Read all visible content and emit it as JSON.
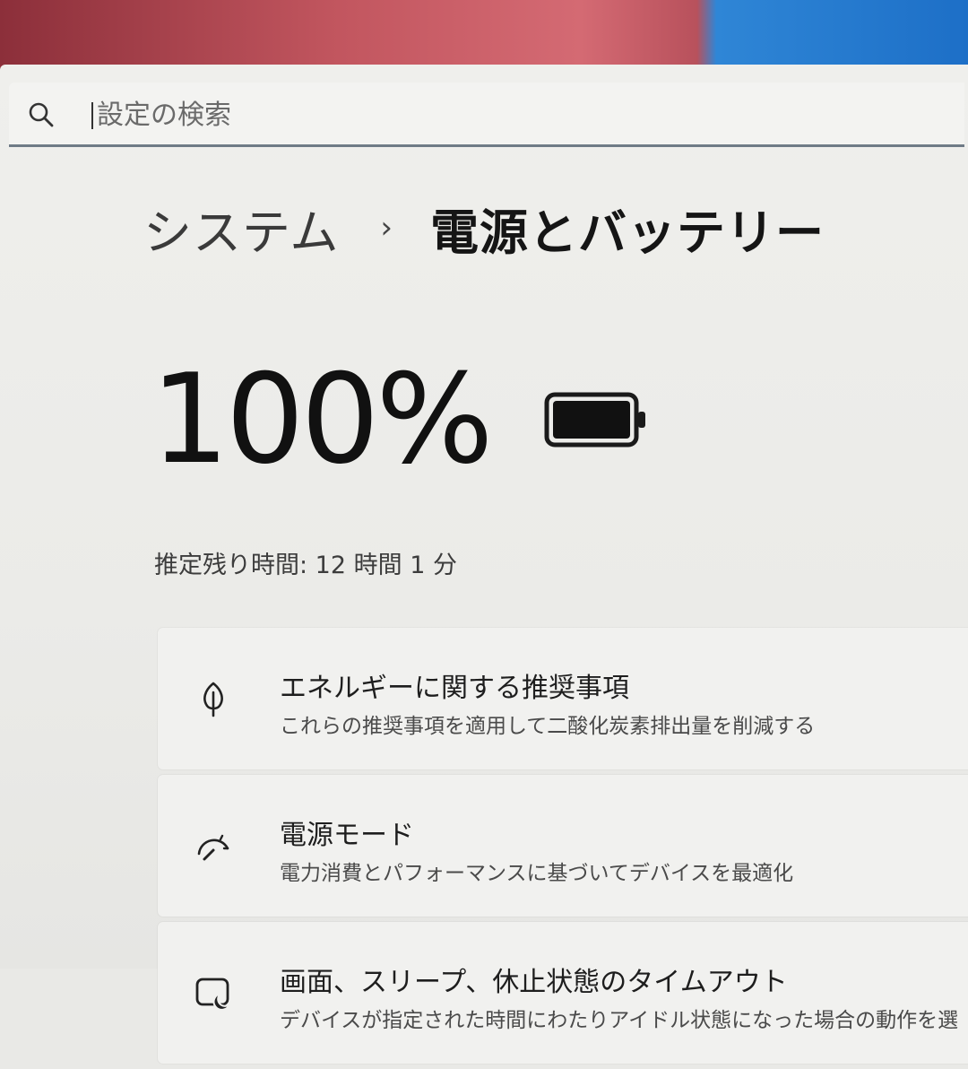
{
  "search": {
    "placeholder": "設定の検索"
  },
  "breadcrumb": {
    "parent": "システム",
    "separator": "›",
    "current": "電源とバッテリー"
  },
  "battery": {
    "percent": "100%",
    "level": 1.0,
    "remaining": "推定残り時間: 12 時間 1 分"
  },
  "cards": [
    {
      "icon": "leaf-icon",
      "title": "エネルギーに関する推奨事項",
      "description": "これらの推奨事項を適用して二酸化炭素排出量を削減する"
    },
    {
      "icon": "gauge-icon",
      "title": "電源モード",
      "description": "電力消費とパフォーマンスに基づいてデバイスを最適化"
    },
    {
      "icon": "sleep-screen-icon",
      "title": "画面、スリープ、休止状態のタイムアウト",
      "description": "デバイスが指定された時間にわたりアイドル状態になった場合の動作を選"
    }
  ]
}
